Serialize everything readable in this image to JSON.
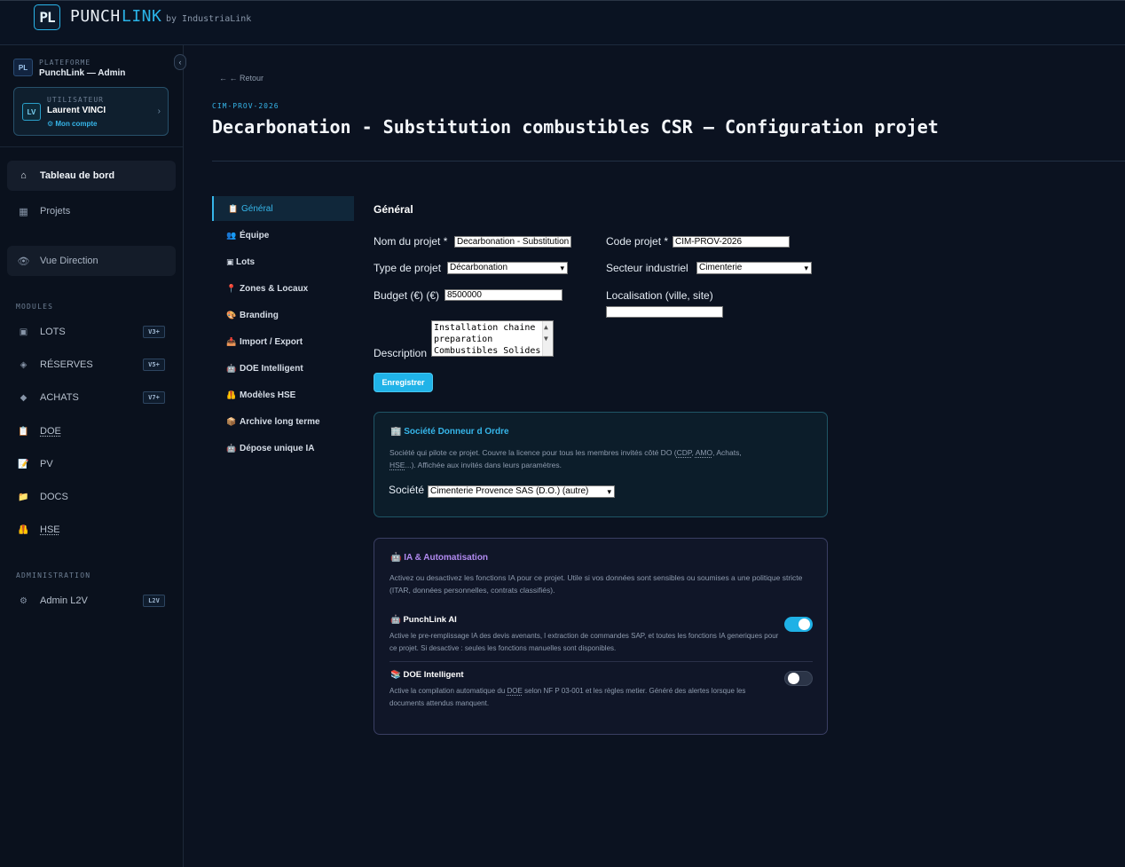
{
  "header": {
    "logo_text": "PL",
    "brand_punch": "PUNCH",
    "brand_link": "LINK",
    "brand_by": "by IndustriaLink"
  },
  "sidebar": {
    "collapse_glyph": "‹",
    "platform": {
      "badge": "PL",
      "label": "PLATEFORME",
      "name": "PunchLink — Admin"
    },
    "user": {
      "avatar": "LV",
      "label": "UTILISATEUR",
      "name": "Laurent VINCI",
      "account_link": "⚙ Mon compte",
      "chevron": "›"
    },
    "nav": [
      {
        "label": "Tableau de bord",
        "icon": "⌂"
      },
      {
        "label": "Projets",
        "icon": "▦"
      },
      {
        "label": "Vue Direction",
        "icon": "👁"
      }
    ],
    "modules_label": "MODULES",
    "modules": [
      {
        "label": "LOTS",
        "icon": "▣",
        "badge": "V3+"
      },
      {
        "label": "RÉSERVES",
        "icon": "◈",
        "badge": "V5+"
      },
      {
        "label": "ACHATS",
        "icon": "◆",
        "badge": "V7+"
      },
      {
        "label": "DOE",
        "icon": "📋"
      },
      {
        "label": "PV",
        "icon": "📝"
      },
      {
        "label": "DOCS",
        "icon": "📁"
      },
      {
        "label": "HSE",
        "icon": "🦺"
      }
    ],
    "admin_label": "ADMINISTRATION",
    "admin": {
      "label": "Admin L2V",
      "icon": "⚙",
      "badge": "L2V"
    }
  },
  "main": {
    "back_link": "← ← Retour",
    "project_code": "CIM-PROV-2026",
    "title": "Decarbonation - Substitution combustibles CSR — Configuration projet",
    "subnav": [
      {
        "label": "Général",
        "icon": "📋"
      },
      {
        "label": "Équipe",
        "icon": "👥"
      },
      {
        "label": "Lots",
        "icon": "▣"
      },
      {
        "label": "Zones & Locaux",
        "icon": "📍"
      },
      {
        "label": "Branding",
        "icon": "🎨"
      },
      {
        "label": "Import / Export",
        "icon": "📥"
      },
      {
        "label": "DOE Intelligent",
        "icon": "🤖"
      },
      {
        "label": "Modèles HSE",
        "icon": "🦺"
      },
      {
        "label": "Archive long terme",
        "icon": "📦"
      },
      {
        "label": "Dépose unique IA",
        "icon": "🤖"
      }
    ],
    "general": {
      "section_title": "Général",
      "nom_label": "Nom du projet *",
      "nom_value": "Decarbonation - Substitution combustibles CSR",
      "code_label": "Code projet *",
      "code_value": "CIM-PROV-2026",
      "type_label": "Type de projet",
      "type_value": "Décarbonation",
      "secteur_label": "Secteur industriel",
      "secteur_value": "Cimenterie",
      "budget_label": "Budget (€) (€)",
      "budget_value": "8500000",
      "localisation_label": "Localisation (ville, site)",
      "localisation_value": "",
      "description_label": "Description",
      "description_value": "Installation chaine preparation Combustibles Solides",
      "save_label": "Enregistrer"
    },
    "donneur_ordre": {
      "title": "🏢 Société Donneur d Ordre",
      "desc_1": "Société qui pilote ce projet. Couvre la licence pour tous les membres invités côté DO (",
      "cdp": "CDP",
      "sep1": ", ",
      "amo": "AMO",
      "desc_2": ", Achats,",
      "hse": "HSE",
      "desc_3": "...). Affichée aux invités dans leurs paramètres.",
      "societe_label": "Société",
      "societe_value": "Cimenterie Provence SAS (D.O.) (autre)"
    },
    "ia": {
      "title": "🤖 IA & Automatisation",
      "desc": "Activez ou desactivez les fonctions IA pour ce projet. Utile si vos données sont sensibles ou soumises a une politique stricte (ITAR, données personnelles, contrats classifiés).",
      "punchlink_ai": {
        "title": "🤖 PunchLink AI",
        "desc": "Active le pre-remplissage IA des devis avenants, l extraction de commandes SAP, et toutes les fonctions IA generiques pour ce projet. Si desactive : seules les fonctions manuelles sont disponibles.",
        "enabled": true
      },
      "doe_intelligent": {
        "title": "📚 DOE Intelligent",
        "desc_1": "Active la compilation automatique du ",
        "doe": "DOE",
        "desc_2": " selon NF P 03-001 et les règles metier. Généré des alertes lorsque les documents attendus manquent.",
        "enabled": false
      }
    }
  },
  "colors": {
    "accent": "#20b3e8",
    "ia_accent": "#b18af0",
    "background": "#0b1220"
  }
}
